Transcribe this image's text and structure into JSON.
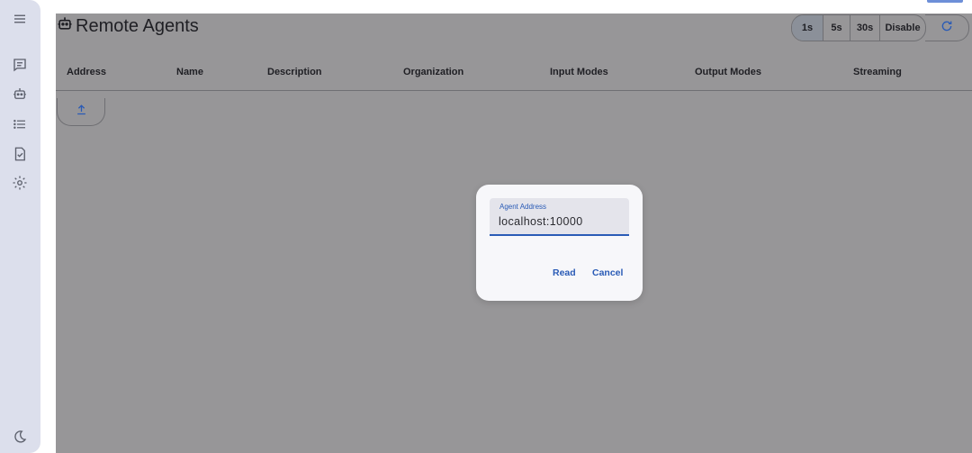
{
  "nav": {
    "items": [
      {
        "name": "menu",
        "icon": "menu-icon"
      },
      {
        "name": "conversations",
        "icon": "chat-icon"
      },
      {
        "name": "agents",
        "icon": "robot-icon"
      },
      {
        "name": "event-list",
        "icon": "list-icon"
      },
      {
        "name": "tasks",
        "icon": "task-check-icon"
      },
      {
        "name": "settings",
        "icon": "settings-icon"
      }
    ],
    "bottom_icon": "dark-mode-icon"
  },
  "page": {
    "title": "Remote Agents",
    "title_icon": "robot-icon"
  },
  "refresh_control": {
    "options": [
      "1s",
      "5s",
      "30s",
      "Disable"
    ],
    "selected": "1s",
    "refresh_icon": "refresh-icon"
  },
  "table": {
    "columns": [
      "Address",
      "Name",
      "Description",
      "Organization",
      "Input Modes",
      "Output Modes",
      "Streaming"
    ]
  },
  "upload_icon": "upload-icon",
  "dialog": {
    "field_label": "Agent Address",
    "field_value": "localhost:10000",
    "read_label": "Read",
    "cancel_label": "Cancel"
  },
  "colors": {
    "accent": "#2a5bb6",
    "overlay": "#979698",
    "rail": "#dcdfec",
    "dialog_bg": "#f7f7fa"
  }
}
